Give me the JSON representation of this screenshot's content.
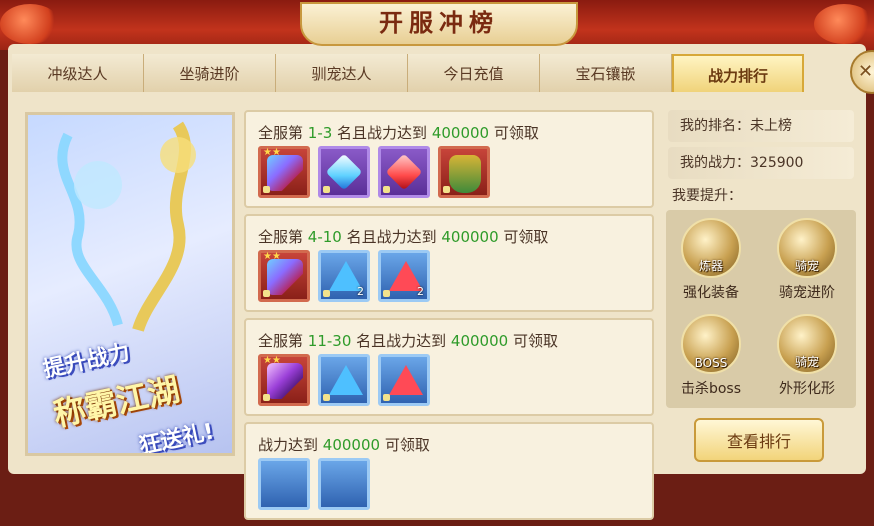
{
  "header": {
    "title": "开服冲榜"
  },
  "tabs": [
    {
      "label": "冲级达人",
      "active": false
    },
    {
      "label": "坐骑进阶",
      "active": false
    },
    {
      "label": "驯宠达人",
      "active": false
    },
    {
      "label": "今日充值",
      "active": false
    },
    {
      "label": "宝石镶嵌",
      "active": false
    },
    {
      "label": "战力排行",
      "active": true
    }
  ],
  "banner": {
    "line1": "提升战力",
    "line2": "称霸江湖",
    "line3": "狂送礼!"
  },
  "rewards": [
    {
      "prefix": "全服第 ",
      "rank": "1-3",
      "middle": " 名且战力达到 ",
      "power": "400000",
      "suffix": " 可领取",
      "items": [
        {
          "icon": "staff-icon",
          "frame": "red"
        },
        {
          "icon": "blue-gem-icon",
          "frame": "purple"
        },
        {
          "icon": "red-gem-icon",
          "frame": "purple"
        },
        {
          "icon": "cloak-icon",
          "frame": "red"
        }
      ]
    },
    {
      "prefix": "全服第 ",
      "rank": "4-10",
      "middle": " 名且战力达到 ",
      "power": "400000",
      "suffix": " 可领取",
      "items": [
        {
          "icon": "staff-icon",
          "frame": "red"
        },
        {
          "icon": "blue-crystal-icon",
          "frame": "blue",
          "count": "2"
        },
        {
          "icon": "red-crystal-icon",
          "frame": "blue",
          "count": "2"
        }
      ]
    },
    {
      "prefix": "全服第 ",
      "rank": "11-30",
      "middle": " 名且战力达到 ",
      "power": "400000",
      "suffix": " 可领取",
      "items": [
        {
          "icon": "staff-icon",
          "frame": "red"
        },
        {
          "icon": "blue-crystal-icon",
          "frame": "blue"
        },
        {
          "icon": "red-crystal-icon",
          "frame": "blue"
        }
      ]
    },
    {
      "prefix": "战力达到 ",
      "power": "400000",
      "suffix": " 可领取"
    }
  ],
  "status": {
    "my_rank": "我的排名：未上榜",
    "my_power": "我的战力：325900",
    "improve_label": "我要提升："
  },
  "improve": [
    {
      "badge": "炼器",
      "label": "强化装备",
      "icon": "refine-icon"
    },
    {
      "badge": "骑宠",
      "label": "骑宠进阶",
      "icon": "mount-pet-icon"
    },
    {
      "badge": "BOSS",
      "label": "击杀boss",
      "icon": "boss-icon"
    },
    {
      "badge": "骑宠",
      "label": "外形化形",
      "icon": "transform-icon"
    }
  ],
  "rank_button": "查看排行"
}
